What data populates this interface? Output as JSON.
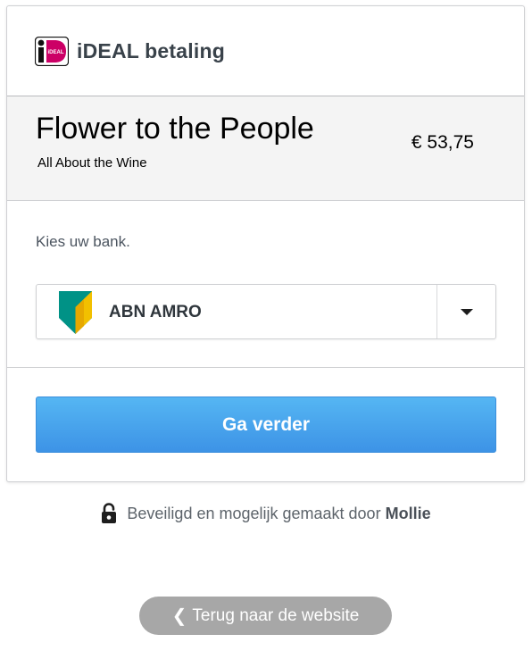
{
  "header": {
    "logo_icon": "ideal-logo-icon",
    "title": "iDEAL betaling",
    "colors": {
      "ideal_pink": "#cc0066"
    }
  },
  "merchant": {
    "name": "Flower to the People",
    "description": "All About the Wine",
    "amount": "€ 53,75"
  },
  "bank": {
    "label": "Kies uw bank.",
    "selected": "ABN AMRO",
    "logo_icon": "abn-amro-logo-icon",
    "dropdown_icon": "caret-down-icon"
  },
  "actions": {
    "continue_label": "Ga verder",
    "back_label": "Terug naar de website",
    "colors": {
      "primary": "#3d93e6",
      "back": "#a7a7a7"
    }
  },
  "footer": {
    "secure_text": "Beveiligd en mogelijk gemaakt door",
    "brand": "Mollie",
    "lock_icon": "unlocked-padlock-icon"
  }
}
